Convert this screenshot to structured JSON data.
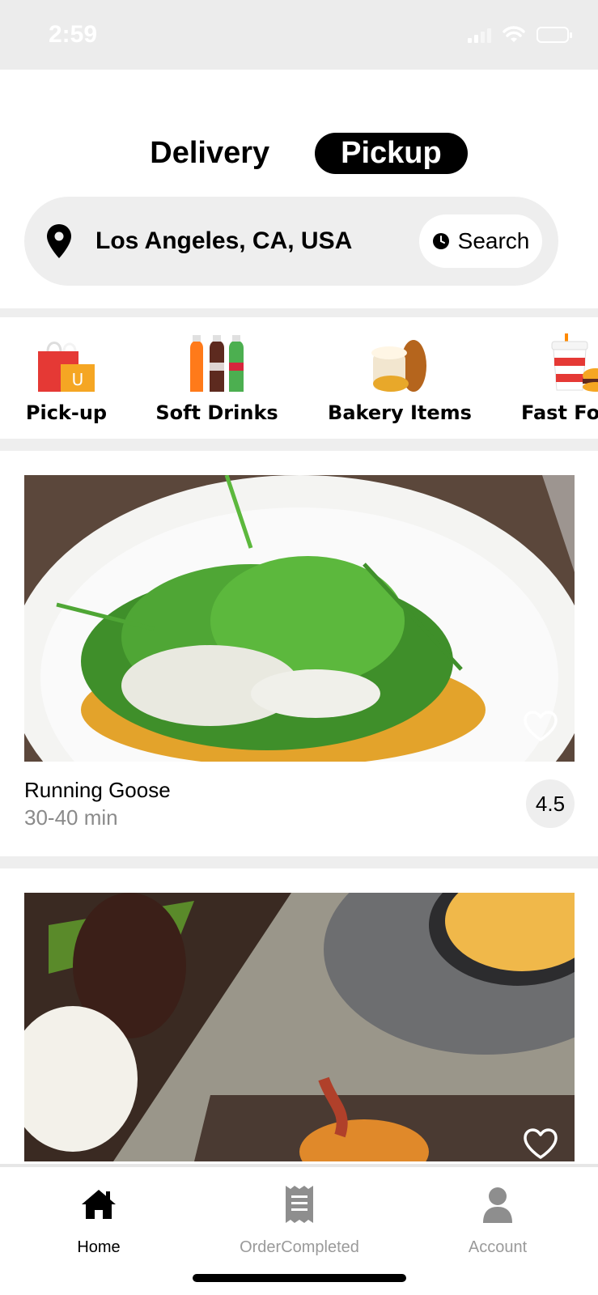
{
  "status_bar": {
    "time": "2:59"
  },
  "mode_toggle": {
    "delivery_label": "Delivery",
    "pickup_label": "Pickup",
    "selected": "Pickup"
  },
  "location_bar": {
    "location": "Los Angeles, CA, USA",
    "search_label": "Search"
  },
  "categories": [
    {
      "label": "Pick-up",
      "icon": "shopping-bags-icon"
    },
    {
      "label": "Soft Drinks",
      "icon": "soda-bottles-icon"
    },
    {
      "label": "Bakery Items",
      "icon": "bread-icon"
    },
    {
      "label": "Fast Fo",
      "icon": "fast-food-icon"
    }
  ],
  "restaurants": [
    {
      "name": "Running Goose",
      "time": "30-40 min",
      "rating": "4.5",
      "favorite": false
    },
    {
      "name": "",
      "time": "",
      "rating": "",
      "favorite": false
    }
  ],
  "tab_bar": {
    "tabs": [
      {
        "label": "Home",
        "icon": "home-icon",
        "active": true
      },
      {
        "label": "OrderCompleted",
        "icon": "receipt-icon",
        "active": false
      },
      {
        "label": "Account",
        "icon": "person-icon",
        "active": false
      }
    ]
  },
  "colors": {
    "accent": "#000000",
    "muted_text": "#8a8a8a",
    "band": "#eeeeee"
  }
}
